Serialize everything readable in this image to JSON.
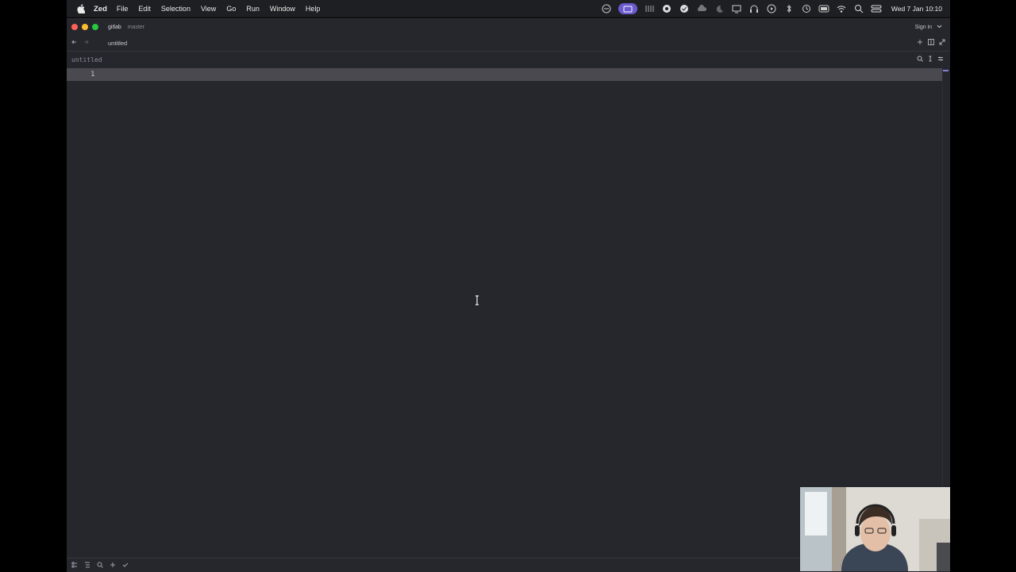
{
  "menubar": {
    "app_name": "Zed",
    "menus": [
      "File",
      "Edit",
      "Selection",
      "View",
      "Go",
      "Run",
      "Window",
      "Help"
    ],
    "clock": "Wed 7 Jan  10:10",
    "status_icons": [
      "display-icon",
      "screen-record-icon",
      "bars-icon",
      "circle-icon",
      "check-circle-icon",
      "cloud-icon",
      "moon-icon",
      "monitor-icon",
      "headphones-icon",
      "play-icon",
      "bluetooth-icon",
      "history-icon",
      "battery-icon",
      "wifi-icon",
      "search-icon",
      "control-center-icon"
    ]
  },
  "titlebar": {
    "project": "gitlab",
    "branch": "master",
    "signin": "Sign in"
  },
  "tabs": [
    {
      "label": "untitled",
      "active": true
    }
  ],
  "breadcrumb": "untitled",
  "editor": {
    "line_number": "1"
  },
  "colors": {
    "accent": "#8b80d9",
    "background": "#26272c",
    "current_line": "#4a4950"
  }
}
